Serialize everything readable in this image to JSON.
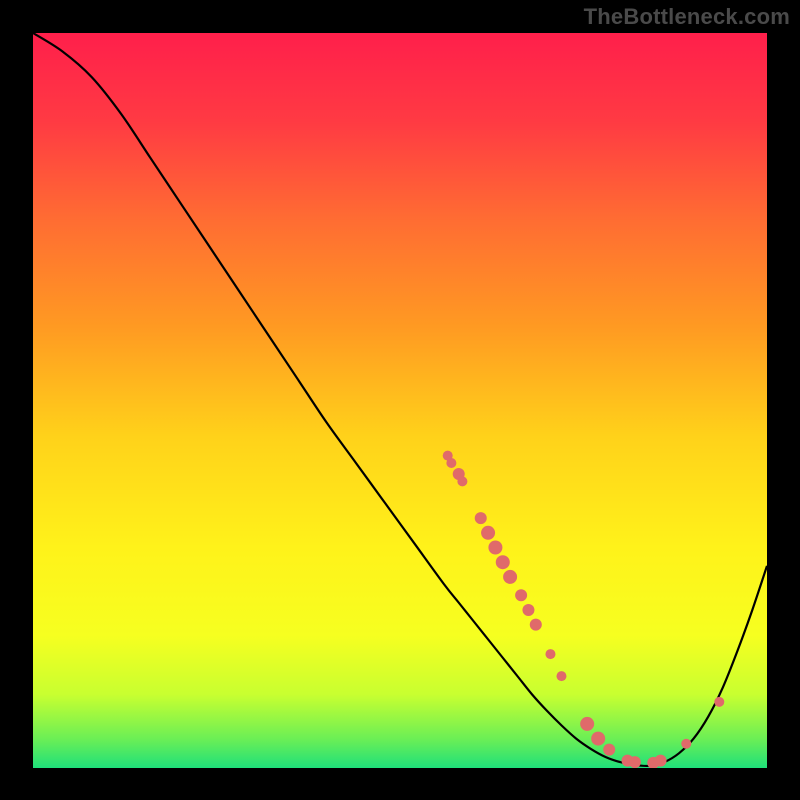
{
  "attribution": "TheBottleneck.com",
  "colors": {
    "page_bg": "#000000",
    "gradient_stops": [
      {
        "offset": 0.0,
        "color": "#ff1f4b"
      },
      {
        "offset": 0.12,
        "color": "#ff3a43"
      },
      {
        "offset": 0.25,
        "color": "#ff6b33"
      },
      {
        "offset": 0.4,
        "color": "#ff9a22"
      },
      {
        "offset": 0.55,
        "color": "#ffd21a"
      },
      {
        "offset": 0.7,
        "color": "#fff21a"
      },
      {
        "offset": 0.82,
        "color": "#f6ff20"
      },
      {
        "offset": 0.9,
        "color": "#c8ff30"
      },
      {
        "offset": 0.96,
        "color": "#6cef55"
      },
      {
        "offset": 1.0,
        "color": "#1fe07a"
      }
    ],
    "curve": "#000000",
    "markers": "#e06a6a"
  },
  "chart_data": {
    "type": "line",
    "title": "",
    "xlabel": "",
    "ylabel": "",
    "xlim": [
      0,
      100
    ],
    "ylim": [
      0,
      100
    ],
    "series": [
      {
        "name": "bottleneck-curve",
        "x": [
          0,
          4,
          8,
          12,
          16,
          20,
          24,
          28,
          32,
          36,
          40,
          44,
          48,
          52,
          56,
          58,
          60,
          62,
          64,
          66,
          68,
          70,
          72,
          74,
          76,
          78,
          80,
          82,
          84,
          86,
          88,
          90,
          92,
          94,
          96,
          98,
          100
        ],
        "y": [
          100,
          97.5,
          94,
          89,
          83,
          77,
          71,
          65,
          59,
          53,
          47,
          41.5,
          36,
          30.5,
          25,
          22.5,
          20,
          17.5,
          15,
          12.5,
          10,
          7.8,
          5.8,
          4.0,
          2.6,
          1.5,
          0.8,
          0.4,
          0.3,
          0.8,
          2.0,
          4.0,
          7.0,
          11.0,
          16.0,
          21.5,
          27.5
        ]
      }
    ],
    "markers": {
      "name": "highlighted-points",
      "color": "#e06a6a",
      "points": [
        {
          "x": 56.5,
          "y": 42.5,
          "r": 5
        },
        {
          "x": 57.0,
          "y": 41.5,
          "r": 5
        },
        {
          "x": 58.0,
          "y": 40.0,
          "r": 6
        },
        {
          "x": 58.5,
          "y": 39.0,
          "r": 5
        },
        {
          "x": 61.0,
          "y": 34.0,
          "r": 6
        },
        {
          "x": 62.0,
          "y": 32.0,
          "r": 7
        },
        {
          "x": 63.0,
          "y": 30.0,
          "r": 7
        },
        {
          "x": 64.0,
          "y": 28.0,
          "r": 7
        },
        {
          "x": 65.0,
          "y": 26.0,
          "r": 7
        },
        {
          "x": 66.5,
          "y": 23.5,
          "r": 6
        },
        {
          "x": 67.5,
          "y": 21.5,
          "r": 6
        },
        {
          "x": 68.5,
          "y": 19.5,
          "r": 6
        },
        {
          "x": 70.5,
          "y": 15.5,
          "r": 5
        },
        {
          "x": 72.0,
          "y": 12.5,
          "r": 5
        },
        {
          "x": 75.5,
          "y": 6.0,
          "r": 7
        },
        {
          "x": 77.0,
          "y": 4.0,
          "r": 7
        },
        {
          "x": 78.5,
          "y": 2.5,
          "r": 6
        },
        {
          "x": 81.0,
          "y": 1.0,
          "r": 6
        },
        {
          "x": 82.0,
          "y": 0.8,
          "r": 6
        },
        {
          "x": 84.5,
          "y": 0.7,
          "r": 6
        },
        {
          "x": 85.5,
          "y": 1.0,
          "r": 6
        },
        {
          "x": 89.0,
          "y": 3.3,
          "r": 5
        },
        {
          "x": 93.5,
          "y": 9.0,
          "r": 5
        }
      ]
    }
  }
}
